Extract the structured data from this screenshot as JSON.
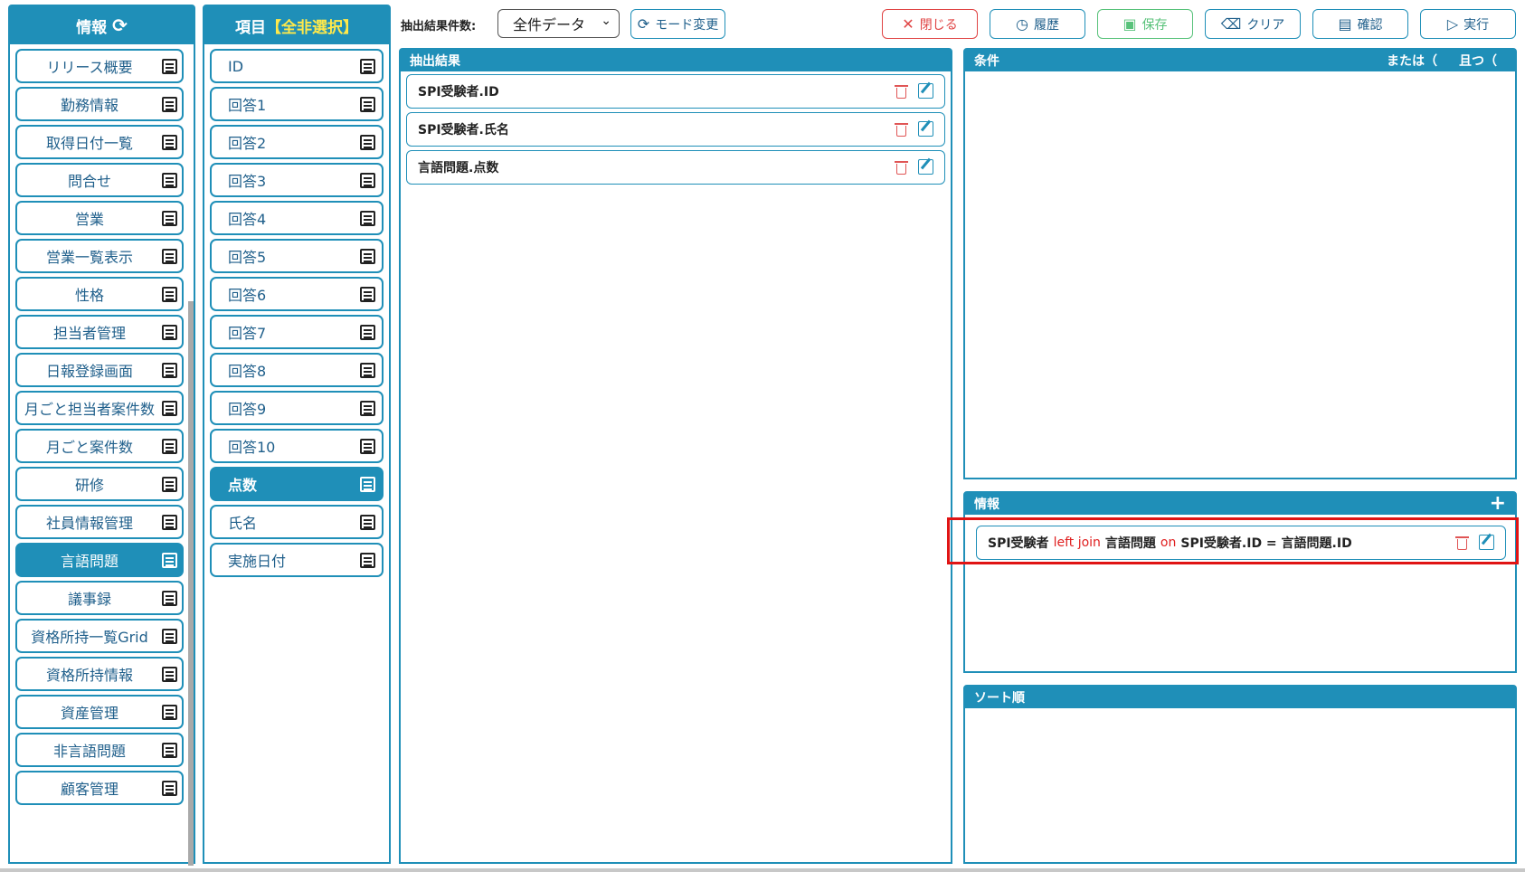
{
  "left_panel": {
    "title": "情報",
    "refresh_icon": "refresh-icon",
    "items": [
      {
        "label": "リリース概要"
      },
      {
        "label": "勤務情報"
      },
      {
        "label": "取得日付一覧"
      },
      {
        "label": "問合せ"
      },
      {
        "label": "営業"
      },
      {
        "label": "営業一覧表示"
      },
      {
        "label": "性格"
      },
      {
        "label": "担当者管理"
      },
      {
        "label": "日報登録画面"
      },
      {
        "label": "月ごと担当者案件数"
      },
      {
        "label": "月ごと案件数"
      },
      {
        "label": "研修"
      },
      {
        "label": "社員情報管理"
      },
      {
        "label": "言語問題",
        "active": true
      },
      {
        "label": "議事録"
      },
      {
        "label": "資格所持一覧Grid"
      },
      {
        "label": "資格所持情報"
      },
      {
        "label": "資産管理"
      },
      {
        "label": "非言語問題"
      },
      {
        "label": "顧客管理"
      }
    ]
  },
  "item_panel": {
    "title_prefix": "項目",
    "title_highlight": "【全非選択】",
    "fields": [
      {
        "label": "ID"
      },
      {
        "label": "回答1"
      },
      {
        "label": "回答2"
      },
      {
        "label": "回答3"
      },
      {
        "label": "回答4"
      },
      {
        "label": "回答5"
      },
      {
        "label": "回答6"
      },
      {
        "label": "回答7"
      },
      {
        "label": "回答8"
      },
      {
        "label": "回答9"
      },
      {
        "label": "回答10"
      },
      {
        "label": "点数",
        "active": true
      },
      {
        "label": "氏名"
      },
      {
        "label": "実施日付"
      }
    ]
  },
  "toolbar": {
    "count_label": "抽出結果件数:",
    "count_select_value": "全件データ",
    "mode_label": "モード変更",
    "close_label": "閉じる",
    "history_label": "履歴",
    "save_label": "保存",
    "clear_label": "クリア",
    "confirm_label": "確認",
    "run_label": "実行",
    "colors": {
      "accent": "#1f8fb8",
      "close": "#e04545",
      "save": "#58c27a"
    }
  },
  "extract_panel": {
    "title": "抽出結果",
    "rows": [
      {
        "label": "SPI受験者.ID"
      },
      {
        "label": "SPI受験者.氏名"
      },
      {
        "label": "言語問題.点数"
      }
    ]
  },
  "condition_panel": {
    "title": "条件",
    "or_label": "または（",
    "and_label": "且つ（"
  },
  "info_panel": {
    "title": "情報",
    "join": {
      "left_table": "SPI受験者",
      "join_keyword": "left join",
      "right_table": "言語問題",
      "on_keyword": "on",
      "condition": "SPI受験者.ID = 言語問題.ID"
    }
  },
  "sort_panel": {
    "title": "ソート順"
  }
}
